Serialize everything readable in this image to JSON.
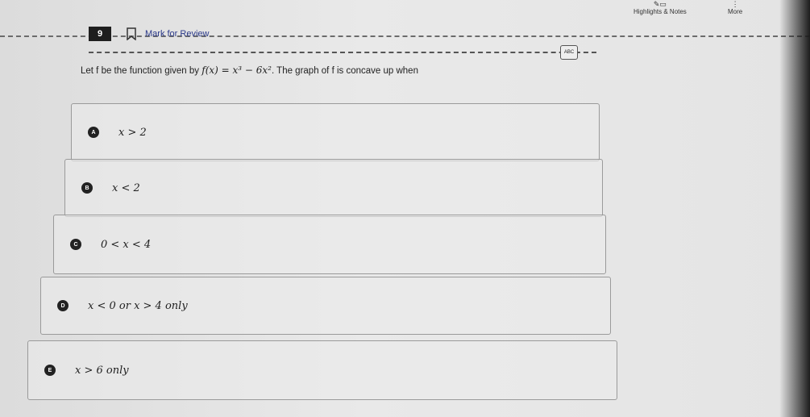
{
  "toolbar": {
    "highlights_label": "Highlights & Notes",
    "more_label": "More"
  },
  "question": {
    "number": "9",
    "mark_label": "Mark for Review",
    "abc_label": "ABC",
    "stem_prefix": "Let f be the function given by ",
    "function_expr": "f(x) = x³ − 6x²",
    "stem_suffix": ". The graph of f is concave up when"
  },
  "options": [
    {
      "letter": "A",
      "text": "x > 2"
    },
    {
      "letter": "B",
      "text": "x < 2"
    },
    {
      "letter": "C",
      "text": "0 < x < 4"
    },
    {
      "letter": "D",
      "text": "x < 0 or x > 4 only"
    },
    {
      "letter": "E",
      "text": "x > 6 only"
    }
  ]
}
